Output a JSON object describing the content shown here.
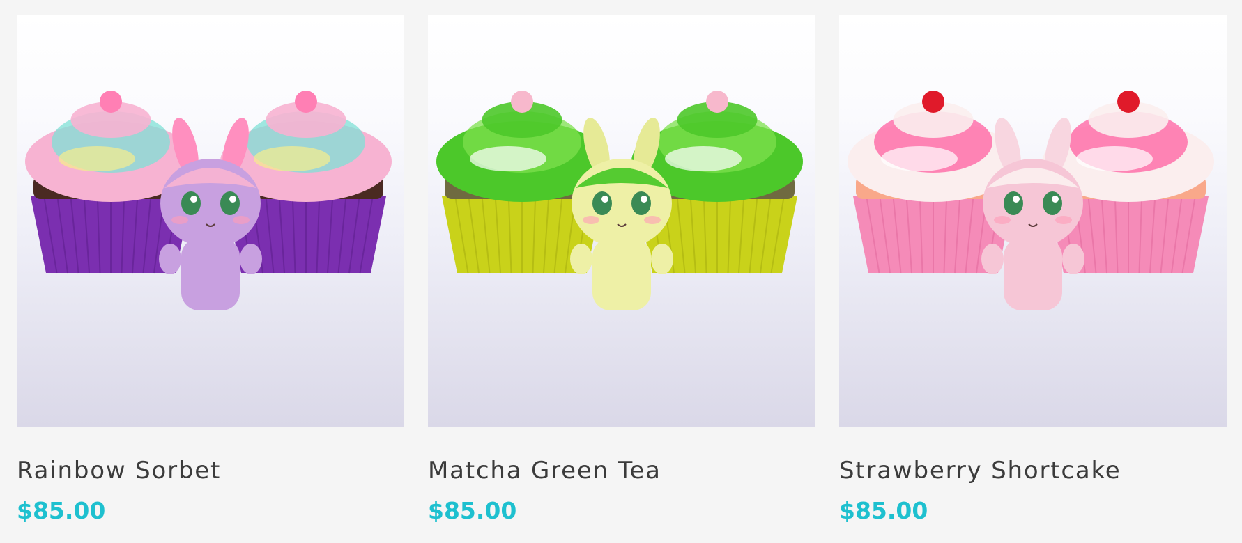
{
  "colors": {
    "price": "#1ec0cf",
    "title": "#3b3b3b",
    "background": "#f5f5f5"
  },
  "products": [
    {
      "title": "Rainbow Sorbet",
      "price": "$85.00",
      "image_icon": "rainbow-sorbet-cupcake-figure-image",
      "palette": {
        "liner": "#7b2fb0",
        "liner_dark": "#5e1f8e",
        "cake": "#4a2a22",
        "frost": "#f7b3d2",
        "frost2": "#7fe0d6",
        "frost3": "#f6ec8c",
        "figure": "#c8a0e0",
        "ears": "#ff8fbf",
        "topper": "#ff7fb4"
      }
    },
    {
      "title": "Matcha Green Tea",
      "price": "$85.00",
      "image_icon": "matcha-green-tea-cupcake-figure-image",
      "palette": {
        "liner": "#c9d21a",
        "liner_dark": "#a8b010",
        "cake": "#6f6a40",
        "frost": "#4cc82a",
        "frost2": "#7ee04e",
        "frost3": "#ffffff",
        "figure": "#eef0a6",
        "ears": "#e6ea96",
        "topper": "#f7b8cc"
      }
    },
    {
      "title": "Strawberry Shortcake",
      "price": "$85.00",
      "image_icon": "strawberry-shortcake-cupcake-figure-image",
      "palette": {
        "liner": "#f58bb8",
        "liner_dark": "#e46b9f",
        "cake": "#f9a88a",
        "frost": "#fbeeee",
        "frost2": "#ff5fa0",
        "frost3": "#ffffff",
        "figure": "#f6c6d6",
        "ears": "#f8d6e0",
        "topper": "#e01a2a"
      }
    }
  ]
}
